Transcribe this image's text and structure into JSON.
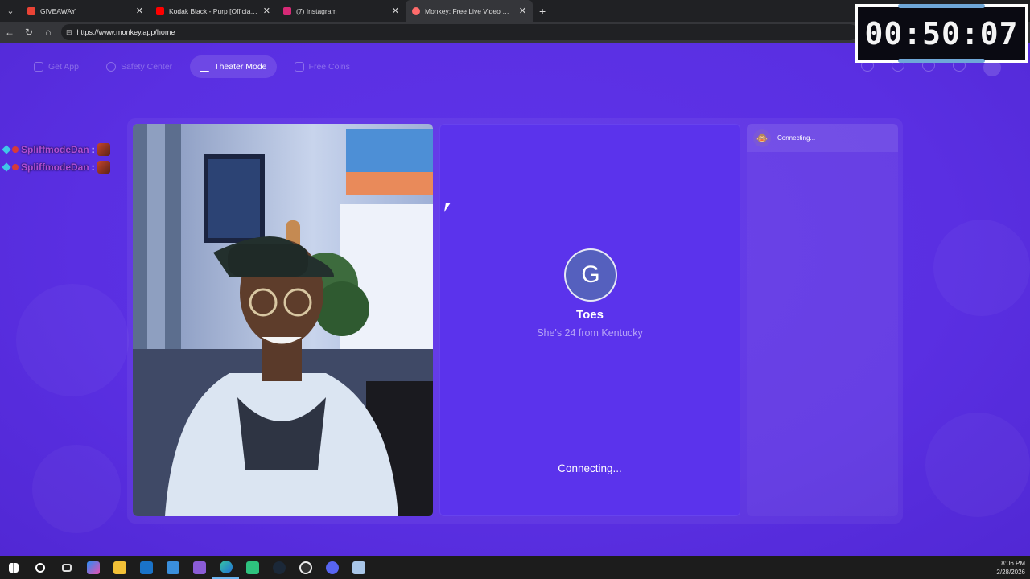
{
  "browser": {
    "tabs": [
      {
        "title": "GIVEAWAY",
        "favicon_color": "#ea4335",
        "active": false
      },
      {
        "title": "Kodak Black - Purp [Official Audio]",
        "favicon_color": "#ff0000",
        "active": false
      },
      {
        "title": "(7) Instagram",
        "favicon_color": "#d62976",
        "active": false
      },
      {
        "title": "Monkey: Free Live Video Chat",
        "favicon_color": "#ff6b6b",
        "active": true
      }
    ],
    "url": "https://www.monkey.app/home"
  },
  "topnav": {
    "items": [
      {
        "label": "Get App",
        "icon": "phone-icon"
      },
      {
        "label": "Safety Center",
        "icon": "shield-icon"
      },
      {
        "label": "Theater Mode",
        "icon": "expand-icon"
      },
      {
        "label": "Free Coins",
        "icon": "coins-icon"
      }
    ]
  },
  "stream_chat": {
    "messages": [
      {
        "user": "SpliffmodeDan",
        "sep": ":"
      },
      {
        "user": "SpliffmodeDan",
        "sep": ":"
      }
    ]
  },
  "timer": {
    "value": "00:50:07"
  },
  "partner": {
    "avatar_letter": "G",
    "name": "Toes",
    "description": "She's 24 from Kentucky",
    "status": "Connecting..."
  },
  "chat_panel": {
    "status": "Connecting..."
  },
  "taskbar": {
    "time": "8:06 PM",
    "date": "2/28/2026"
  },
  "colors": {
    "page_bg": "#5b30e6",
    "accent": "#5560be"
  }
}
